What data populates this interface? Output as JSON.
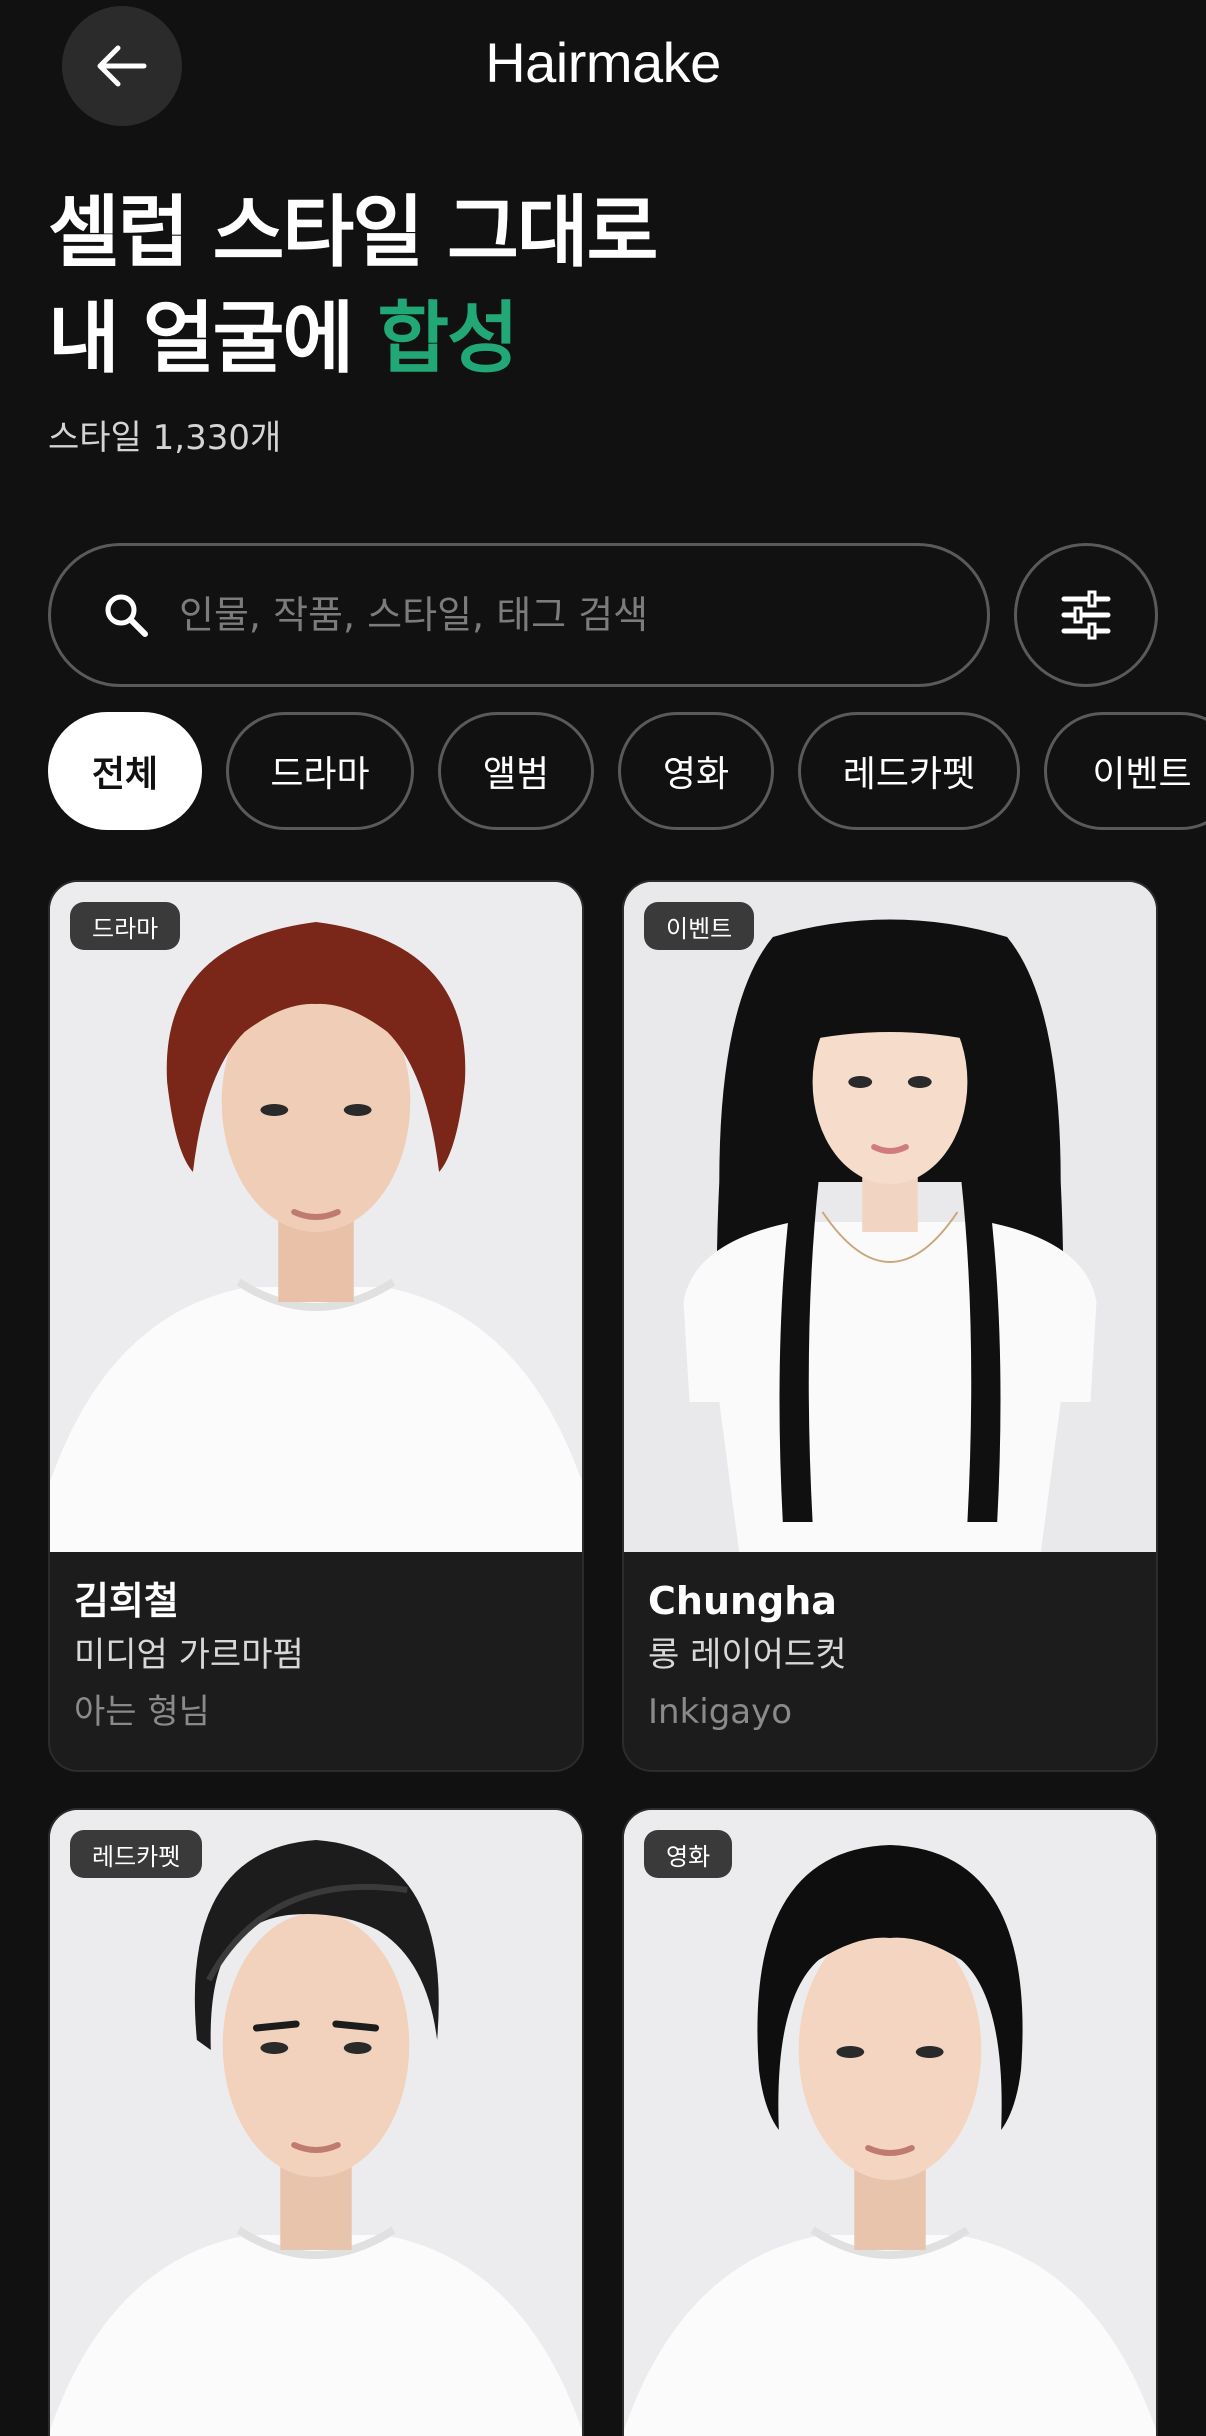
{
  "header": {
    "brand": "Hairmake"
  },
  "hero": {
    "line1": "셀럽 스타일 그대로",
    "line2_prefix": "내 얼굴에 ",
    "line2_accent": "합성",
    "count_text": "스타일 1,330개"
  },
  "search": {
    "placeholder": "인물, 작품, 스타일, 태그 검색",
    "value": ""
  },
  "categories": [
    "전체",
    "드라마",
    "앨범",
    "영화",
    "레드카펫",
    "이벤트"
  ],
  "selected_category": "전체",
  "cards": [
    {
      "badge": "드라마",
      "name": "김희철",
      "style": "미디엄 가르마펌",
      "source": "아는 형님"
    },
    {
      "badge": "이벤트",
      "name": "Chungha",
      "style": "롱 레이어드컷",
      "source": "Inkigayo"
    },
    {
      "badge": "레드카펫",
      "name": "",
      "style": "",
      "source": ""
    },
    {
      "badge": "영화",
      "name": "",
      "style": "",
      "source": ""
    }
  ],
  "colors": {
    "background": "#111111",
    "accent": "#22a876",
    "chip_active": "#ffffff",
    "border": "#5a5a5a"
  },
  "icons": {
    "back": "arrow-left-icon",
    "search": "search-icon",
    "filter": "sliders-icon"
  }
}
